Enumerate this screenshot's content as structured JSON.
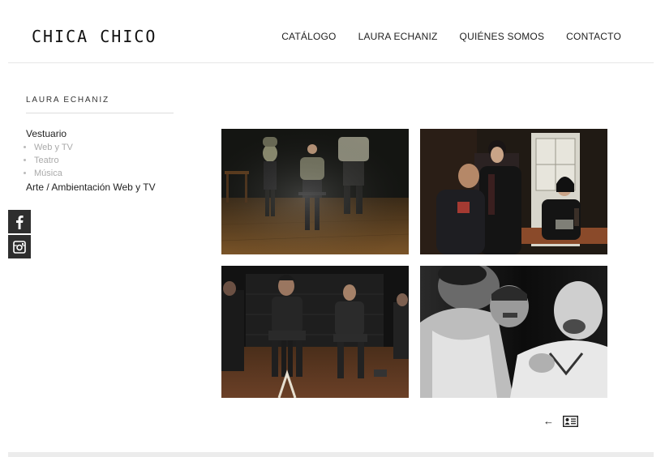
{
  "header": {
    "logo": "CHICA CHICO",
    "nav": [
      "CATÁLOGO",
      "LAURA ECHANIZ",
      "QUIÉNES SOMOS",
      "CONTACTO"
    ]
  },
  "sidebar": {
    "title": "LAURA ECHANIZ",
    "categories": [
      {
        "label": "Vestuario",
        "subitems": [
          "Web y TV",
          "Teatro",
          "Música"
        ]
      },
      {
        "label": "Arte / Ambientación Web y TV",
        "subitems": []
      }
    ]
  },
  "social": [
    {
      "name": "facebook",
      "glyph": "f"
    },
    {
      "name": "instagram",
      "glyph": "instagram"
    }
  ],
  "pager": {
    "prev_glyph": "←",
    "icon": "id-card-icon"
  },
  "colors": {
    "sidebar_subitem": "#aaaaaa",
    "social_bg": "#2e2e2e",
    "divider": "#e6e6e6"
  }
}
